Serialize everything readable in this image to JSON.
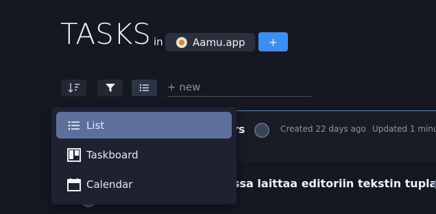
{
  "header": {
    "title": "TASKS",
    "in_word": "in",
    "project_name": "Aamu.app",
    "add_label": "+"
  },
  "toolbar": {
    "sort_icon": "sort-icon",
    "filter_icon": "filter-icon",
    "view_icon": "list-icon",
    "new_placeholder": "+ new"
  },
  "view_menu": {
    "items": [
      {
        "label": "List",
        "icon": "list-icon",
        "selected": true
      },
      {
        "label": "Taskboard",
        "icon": "taskboard-icon",
        "selected": false
      },
      {
        "label": "Calendar",
        "icon": "calendar-icon",
        "selected": false
      }
    ]
  },
  "tasks": [
    {
      "title_partial": "rs",
      "created": "Created 22 days ago",
      "updated": "Updated 1 minu"
    },
    {
      "title_partial": "ssa laittaa editoriin tekstin tuplana"
    }
  ],
  "colors": {
    "background": "#151821",
    "accent": "#3b8ff0",
    "menu_selected": "#5d6f9c",
    "card_border": "#4a8fc9"
  }
}
